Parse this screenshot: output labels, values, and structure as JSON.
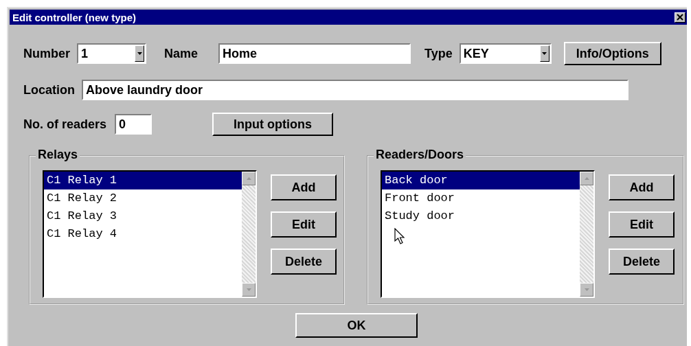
{
  "window": {
    "title": "Edit controller (new type)"
  },
  "number": {
    "label": "Number",
    "value": "1"
  },
  "name": {
    "label": "Name",
    "value": "Home"
  },
  "type": {
    "label": "Type",
    "value": "KEY"
  },
  "info_button": "Info/Options",
  "location": {
    "label": "Location",
    "value": "Above laundry door"
  },
  "readers": {
    "label": "No. of readers",
    "value": "0"
  },
  "input_options_button": "Input options",
  "groups": [
    {
      "title": "Relays",
      "items": [
        {
          "label": "C1 Relay 1",
          "selected": true
        },
        {
          "label": "C1 Relay 2",
          "selected": false
        },
        {
          "label": "C1 Relay 3",
          "selected": false
        },
        {
          "label": "C1 Relay 4",
          "selected": false
        }
      ],
      "buttons": [
        "Add",
        "Edit",
        "Delete"
      ]
    },
    {
      "title": "Readers/Doors",
      "items": [
        {
          "label": "Back door",
          "selected": true
        },
        {
          "label": "Front door",
          "selected": false
        },
        {
          "label": "Study door",
          "selected": false
        }
      ],
      "buttons": [
        "Add",
        "Edit",
        "Delete"
      ]
    }
  ],
  "ok_button": "OK"
}
